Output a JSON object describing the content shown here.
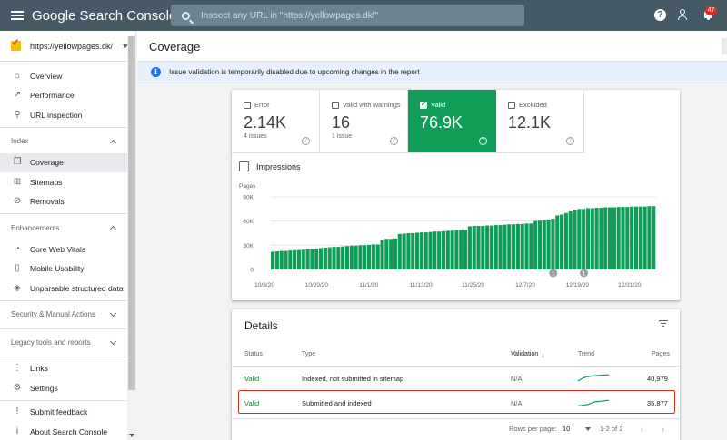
{
  "app": {
    "title": "Google Search Console",
    "search_placeholder": "Inspect any URL in \"https://yellowpages.dk/\"",
    "notifications": "47",
    "help_glyph": "?"
  },
  "sidebar": {
    "property": "https://yellowpages.dk/",
    "top_items": [
      {
        "label": "Overview",
        "icon": "home-icon",
        "glyph": "⌂"
      },
      {
        "label": "Performance",
        "icon": "trending-up-icon",
        "glyph": "↗"
      },
      {
        "label": "URL inspection",
        "icon": "search-icon",
        "glyph": "⚲"
      }
    ],
    "index": {
      "title": "Index",
      "items": [
        {
          "label": "Coverage",
          "icon": "file-copy-icon",
          "glyph": "❐"
        },
        {
          "label": "Sitemaps",
          "icon": "sitemap-icon",
          "glyph": "⊞"
        },
        {
          "label": "Removals",
          "icon": "visibility-off-icon",
          "glyph": "⊘"
        }
      ]
    },
    "enhancements": {
      "title": "Enhancements",
      "items": [
        {
          "label": "Core Web Vitals",
          "icon": "speed-icon",
          "glyph": "◔"
        },
        {
          "label": "Mobile Usability",
          "icon": "smartphone-icon",
          "glyph": "▯"
        },
        {
          "label": "Unparsable structured data",
          "icon": "layers-icon",
          "glyph": "◈"
        }
      ]
    },
    "security": "Security & Manual Actions",
    "legacy": "Legacy tools and reports",
    "bottom_items": [
      {
        "label": "Links",
        "icon": "links-icon",
        "glyph": "⋮"
      },
      {
        "label": "Settings",
        "icon": "gear-icon",
        "glyph": "⚙"
      }
    ],
    "footer_items": [
      {
        "label": "Submit feedback",
        "icon": "feedback-icon",
        "glyph": "!"
      },
      {
        "label": "About Search Console",
        "icon": "info-icon",
        "glyph": "i"
      }
    ]
  },
  "page": {
    "title": "Coverage",
    "banner": "Issue validation is temporarily disabled due to upcoming changes in the report",
    "banner_glyph": "i"
  },
  "tiles": [
    {
      "label": "Error",
      "value": "2.14K",
      "sub": "4 issues",
      "selected": false
    },
    {
      "label": "Valid with warnings",
      "value": "16",
      "sub": "1 issue",
      "selected": false
    },
    {
      "label": "Valid",
      "value": "76.9K",
      "sub": "",
      "selected": true
    },
    {
      "label": "Excluded",
      "value": "12.1K",
      "sub": "",
      "selected": false
    }
  ],
  "impressions_label": "Impressions",
  "chart_data": {
    "type": "bar",
    "ylabel": "Pages",
    "ylim": [
      0,
      90000
    ],
    "yticks": [
      "90K",
      "60K",
      "30K",
      "0"
    ],
    "yticks_values": [
      90000,
      60000,
      30000,
      0
    ],
    "xticks": [
      "10/8/20",
      "10/20/20",
      "11/1/20",
      "11/13/20",
      "11/25/20",
      "12/7/20",
      "12/19/20",
      "12/31/20"
    ],
    "markers": [
      {
        "label": "1",
        "index": 64
      },
      {
        "label": "1",
        "index": 71
      }
    ],
    "color": "#0f9d58",
    "values": [
      22000,
      22500,
      23000,
      23000,
      23500,
      24000,
      24000,
      24500,
      25000,
      25000,
      26000,
      26500,
      27000,
      27500,
      28000,
      28000,
      28500,
      29000,
      29500,
      29500,
      30000,
      30000,
      30500,
      31000,
      31000,
      36000,
      38000,
      38000,
      38500,
      44000,
      44500,
      45000,
      45000,
      45500,
      46000,
      46000,
      46500,
      47000,
      47000,
      47500,
      48000,
      48000,
      48500,
      49000,
      49000,
      53500,
      54000,
      54000,
      54000,
      54500,
      54500,
      55000,
      55000,
      55500,
      56000,
      56000,
      56500,
      56500,
      57000,
      57000,
      60000,
      60500,
      61000,
      62000,
      63000,
      67000,
      68000,
      70000,
      72000,
      74000,
      75000,
      75000,
      76000,
      76000,
      76500,
      76500,
      77000,
      77000,
      77000,
      77500,
      77500,
      77500,
      78000,
      78000,
      78000,
      78000,
      78500,
      78500
    ]
  },
  "details": {
    "title": "Details",
    "headers": {
      "status": "Status",
      "type": "Type",
      "validation": "Validation",
      "trend": "Trend",
      "pages": "Pages"
    },
    "rows": [
      {
        "status": "Valid",
        "type": "Indexed, not submitted in sitemap",
        "validation": "N/A",
        "pages": "40,979",
        "trend": [
          0.2,
          0.4,
          0.55,
          0.62,
          0.68,
          0.72,
          0.75,
          0.76,
          0.78,
          0.78
        ]
      },
      {
        "status": "Valid",
        "type": "Submitted and indexed",
        "validation": "N/A",
        "pages": "35,877",
        "trend": [
          0.15,
          0.2,
          0.25,
          0.3,
          0.45,
          0.55,
          0.6,
          0.62,
          0.68,
          0.7
        ]
      }
    ],
    "rows_per_page_label": "Rows per page:",
    "rows_per_page": "10",
    "range": "1-2 of 2"
  }
}
